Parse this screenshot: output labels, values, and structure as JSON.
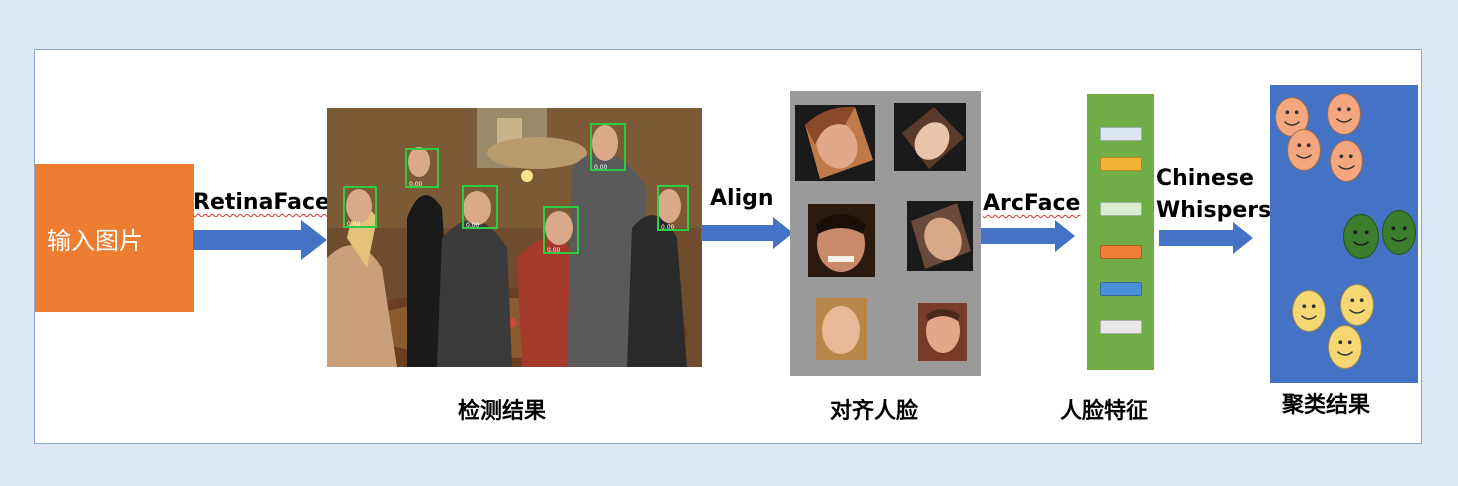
{
  "diagram": {
    "input_label": "输入图片",
    "steps": {
      "detect": "RetinaFace",
      "align": "Align",
      "embed": "ArcFace",
      "cluster_line1": "Chinese",
      "cluster_line2": "Whispers"
    },
    "captions": {
      "detection": "检测结果",
      "aligned": "对齐人脸",
      "features": "人脸特征",
      "clusters": "聚类结果"
    },
    "detection_score": "0.00",
    "colors": {
      "background": "#dde8f4",
      "input_box": "#ed7d31",
      "arrow": "#4472c4",
      "feature_bar": "#70ad47",
      "cluster_panel": "#4472c4",
      "aligned_panel": "#9a9a9a",
      "box": "#2ecc40",
      "cluster_orange": "#f4a77e",
      "cluster_green": "#3a7d2c",
      "cluster_yellow": "#f7d774"
    },
    "feature_cells": [
      "#dce6f2",
      "#f5b335",
      "#d8efcf",
      "#f07d37",
      "#4a8fd8",
      "#e8e8e8"
    ],
    "clusters": [
      {
        "color_name": "orange",
        "count": 4
      },
      {
        "color_name": "green",
        "count": 2
      },
      {
        "color_name": "yellow",
        "count": 3
      }
    ]
  }
}
